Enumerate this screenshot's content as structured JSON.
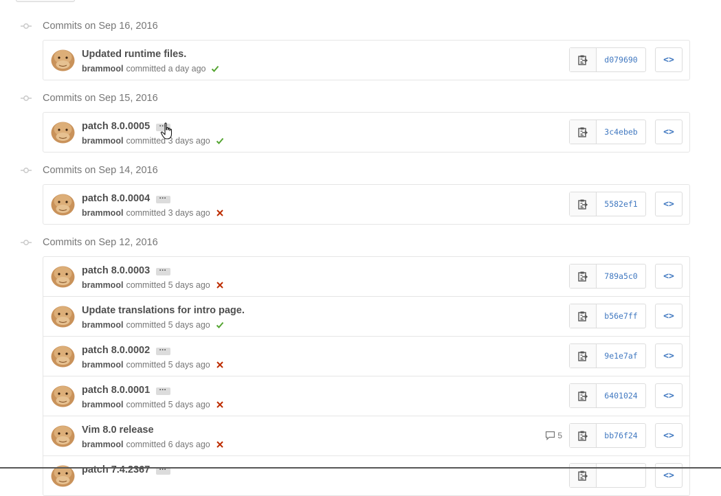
{
  "groups": [
    {
      "title": "Commits on Sep 16, 2016",
      "commits": [
        {
          "title": "Updated runtime files.",
          "author": "brammool",
          "time": "committed a day ago",
          "status": "success",
          "sha": "d079690",
          "has_more": false,
          "comments": ""
        }
      ]
    },
    {
      "title": "Commits on Sep 15, 2016",
      "commits": [
        {
          "title": "patch 8.0.0005",
          "author": "brammool",
          "time": "committed 3 days ago",
          "status": "success",
          "sha": "3c4ebeb",
          "has_more": true,
          "comments": ""
        }
      ]
    },
    {
      "title": "Commits on Sep 14, 2016",
      "commits": [
        {
          "title": "patch 8.0.0004",
          "author": "brammool",
          "time": "committed 3 days ago",
          "status": "failure",
          "sha": "5582ef1",
          "has_more": true,
          "comments": ""
        }
      ]
    },
    {
      "title": "Commits on Sep 12, 2016",
      "commits": [
        {
          "title": "patch 8.0.0003",
          "author": "brammool",
          "time": "committed 5 days ago",
          "status": "failure",
          "sha": "789a5c0",
          "has_more": true,
          "comments": ""
        },
        {
          "title": "Update translations for intro page.",
          "author": "brammool",
          "time": "committed 5 days ago",
          "status": "success",
          "sha": "b56e7ff",
          "has_more": false,
          "comments": ""
        },
        {
          "title": "patch 8.0.0002",
          "author": "brammool",
          "time": "committed 5 days ago",
          "status": "failure",
          "sha": "9e1e7af",
          "has_more": true,
          "comments": ""
        },
        {
          "title": "patch 8.0.0001",
          "author": "brammool",
          "time": "committed 5 days ago",
          "status": "failure",
          "sha": "6401024",
          "has_more": true,
          "comments": ""
        },
        {
          "title": "Vim 8.0 release",
          "author": "brammool",
          "time": "committed 6 days ago",
          "status": "failure",
          "sha": "bb76f24",
          "has_more": false,
          "comments": "5"
        },
        {
          "title": "patch 7.4.2367",
          "author": "",
          "time": "",
          "status": "",
          "sha": "",
          "has_more": true,
          "comments": ""
        }
      ]
    }
  ],
  "icons": {
    "group_node": "git-commit-icon",
    "copy": "clippy-icon",
    "browse": "code-icon",
    "success": "check-icon",
    "failure": "x-icon",
    "comment": "comment-icon",
    "more": "ellipsis-icon",
    "cursor": "hand-pointer-cursor"
  },
  "colors": {
    "success": "#55a532",
    "failure": "#bd2c00",
    "sha_link": "#4078c0",
    "border": "#e5e5e5"
  }
}
